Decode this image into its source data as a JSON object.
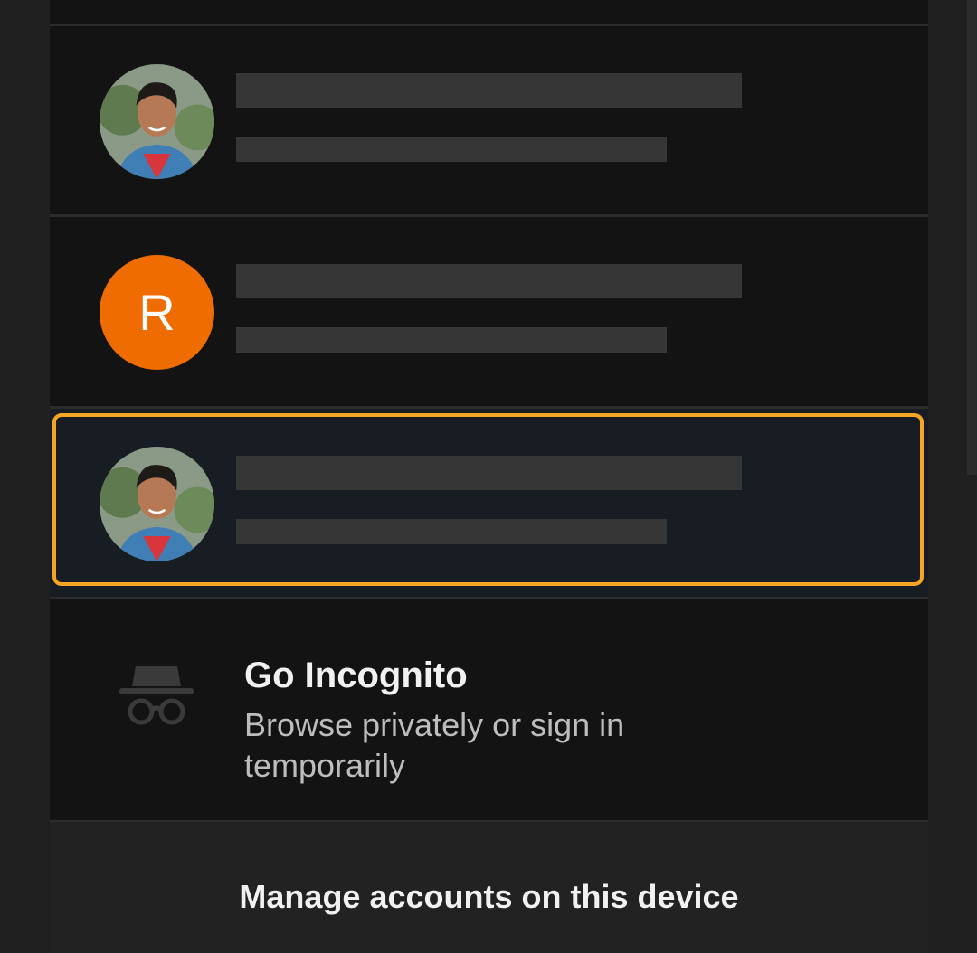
{
  "accounts": [
    {
      "avatar_type": "photo",
      "avatar_icon": "person-photo-avatar"
    },
    {
      "avatar_type": "letter",
      "avatar_letter": "R",
      "avatar_color": "#ef6c00"
    },
    {
      "avatar_type": "photo",
      "avatar_icon": "person-photo-avatar",
      "selected": true
    }
  ],
  "incognito": {
    "title": "Go Incognito",
    "subtitle": "Browse privately or sign in temporarily",
    "icon": "incognito-icon"
  },
  "manage": {
    "label": "Manage accounts on this device"
  },
  "colors": {
    "focus_ring": "#f5a623",
    "panel_bg": "#131313",
    "selected_bg": "#171d22"
  }
}
